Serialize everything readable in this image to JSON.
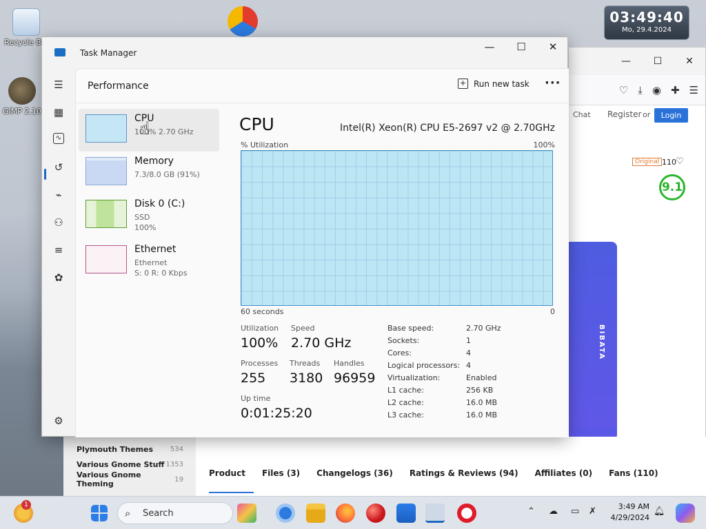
{
  "desktop": {
    "icons": [
      {
        "label": "Recycle Bin"
      },
      {
        "label": "GIMP 2.10"
      }
    ],
    "clock_widget": {
      "time": "03:49:40",
      "date": "Mo, 29.4.2024"
    }
  },
  "browser": {
    "chat": "Chat",
    "register": "Register",
    "or": "or",
    "login": "Login",
    "original_badge": "Original",
    "likes": "110",
    "score": "9.1",
    "banner": "BIBATA",
    "categories": [
      {
        "name": "Plymouth Themes",
        "count": "534"
      },
      {
        "name": "Various Gnome Stuff",
        "count": "1353"
      },
      {
        "name": "Various Gnome Theming",
        "count": "19"
      }
    ],
    "tabs": [
      "Product",
      "Files (3)",
      "Changelogs (36)",
      "Ratings & Reviews (94)",
      "Affiliates (0)",
      "Fans (110)"
    ]
  },
  "tm": {
    "title": "Task Manager",
    "page": "Performance",
    "run_task": "Run new task",
    "more": "···",
    "sidebar": [
      {
        "title": "CPU",
        "sub1": "100% 2.70 GHz",
        "sub2": "",
        "sub3": ""
      },
      {
        "title": "Memory",
        "sub1": "7.3/8.0 GB (91%)",
        "sub2": "",
        "sub3": ""
      },
      {
        "title": "Disk 0 (C:)",
        "sub1": "SSD",
        "sub2": "100%",
        "sub3": ""
      },
      {
        "title": "Ethernet",
        "sub1": "Ethernet",
        "sub2": "S: 0 R: 0 Kbps",
        "sub3": ""
      }
    ],
    "cpu": {
      "heading": "CPU",
      "model": "Intel(R) Xeon(R) CPU E5-2697 v2 @ 2.70GHz",
      "util_label": "% Utilization",
      "util_max": "100%",
      "time_label": "60 seconds",
      "zero": "0",
      "stats": {
        "utilization_label": "Utilization",
        "utilization": "100%",
        "speed_label": "Speed",
        "speed": "2.70 GHz",
        "processes_label": "Processes",
        "processes": "255",
        "threads_label": "Threads",
        "threads": "3180",
        "handles_label": "Handles",
        "handles": "96959",
        "uptime_label": "Up time",
        "uptime": "0:01:25:20"
      },
      "details": [
        {
          "k": "Base speed:",
          "v": "2.70 GHz"
        },
        {
          "k": "Sockets:",
          "v": "1"
        },
        {
          "k": "Cores:",
          "v": "4"
        },
        {
          "k": "Logical processors:",
          "v": "4"
        },
        {
          "k": "Virtualization:",
          "v": "Enabled"
        },
        {
          "k": "L1 cache:",
          "v": "256 KB"
        },
        {
          "k": "L2 cache:",
          "v": "16.0 MB"
        },
        {
          "k": "L3 cache:",
          "v": "16.0 MB"
        }
      ]
    }
  },
  "taskbar": {
    "search": "Search",
    "notif_count": "1",
    "time": "3:49 AM",
    "date": "4/29/2024"
  }
}
